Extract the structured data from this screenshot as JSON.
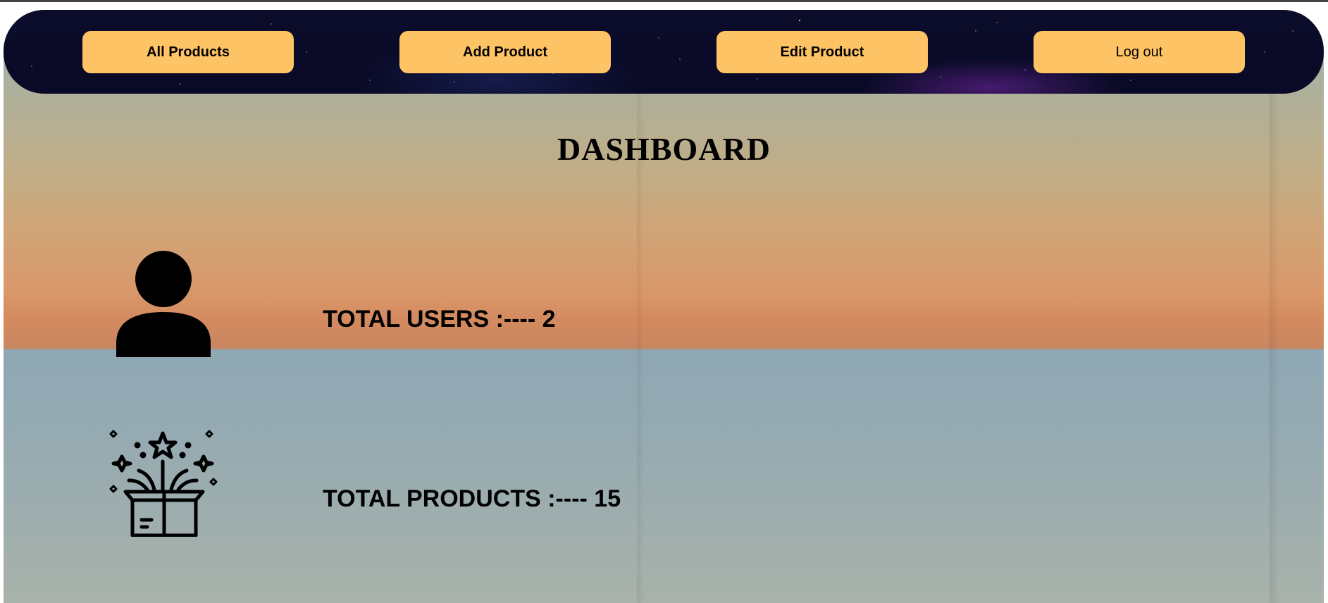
{
  "nav": {
    "all_products": "All Products",
    "add_product": "Add Product",
    "edit_product": "Edit Product",
    "logout": "Log out"
  },
  "main": {
    "title": "DASHBOARD",
    "users": {
      "label": "TOTAL USERS :----",
      "value": "2",
      "icon": "user-icon"
    },
    "products": {
      "label": "TOTAL PRODUCTS :----",
      "value": "15",
      "icon": "gift-box-icon"
    }
  },
  "colors": {
    "button_bg": "#fec365",
    "navbar_bg": "#0b0c2a"
  }
}
